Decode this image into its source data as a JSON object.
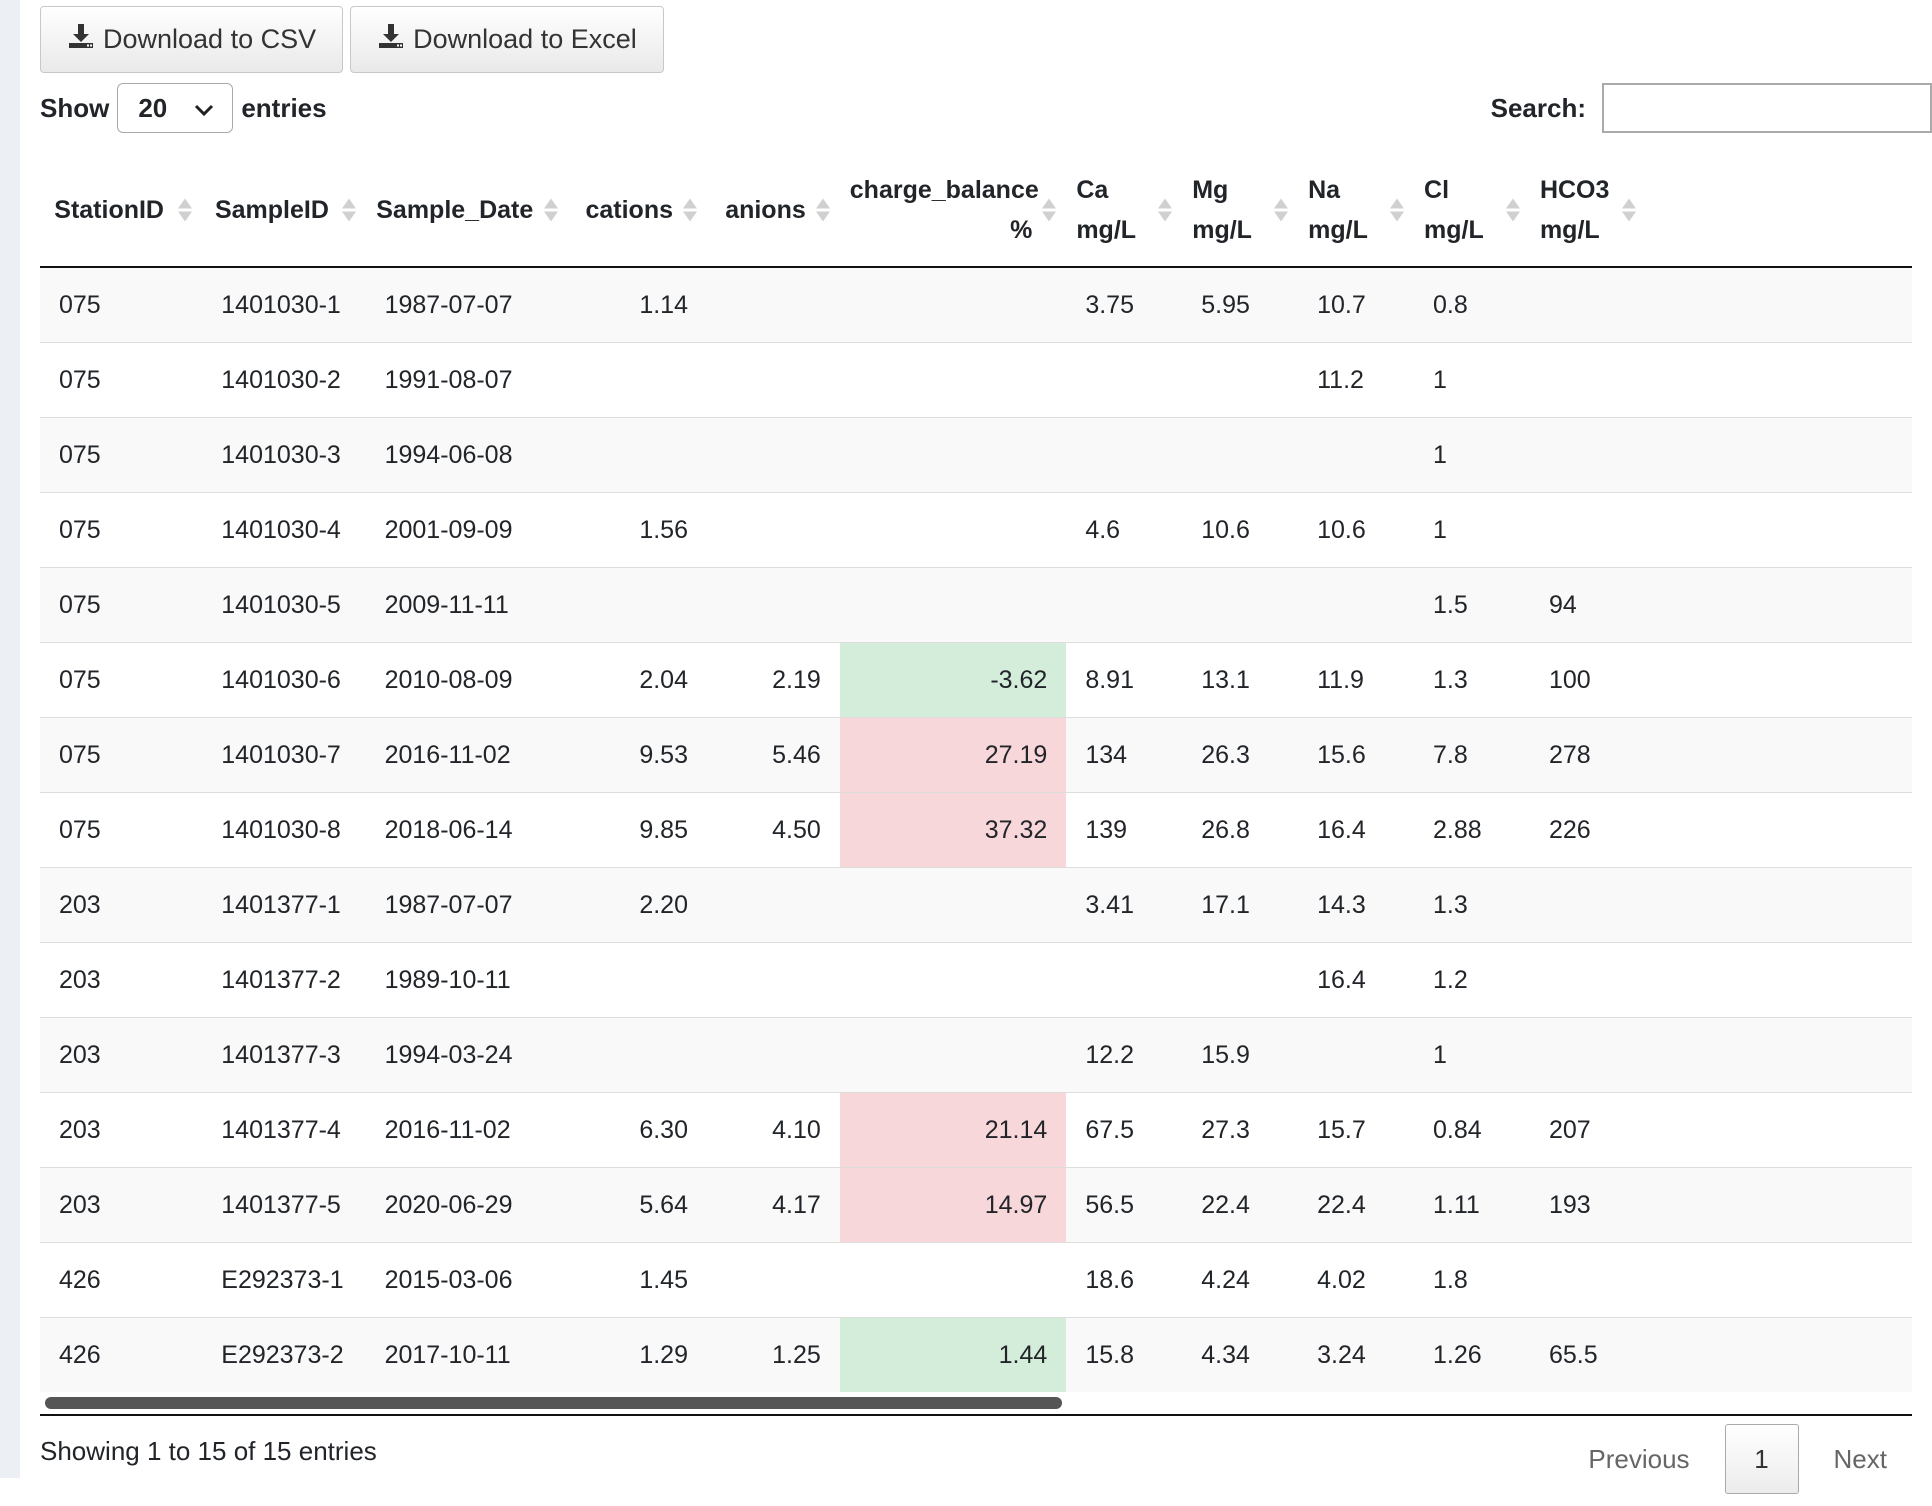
{
  "toolbar": {
    "csv_label": "Download to CSV",
    "excel_label": "Download to Excel"
  },
  "length": {
    "show_label": "Show",
    "selected": "20",
    "entries_label": "entries"
  },
  "search": {
    "label": "Search:",
    "value": ""
  },
  "table": {
    "headers": [
      {
        "l1": "StationID",
        "l2": ""
      },
      {
        "l1": "SampleID",
        "l2": ""
      },
      {
        "l1": "Sample_Date",
        "l2": ""
      },
      {
        "l1": "cations",
        "l2": ""
      },
      {
        "l1": "anions",
        "l2": ""
      },
      {
        "l1": "charge_balance",
        "l2": "%"
      },
      {
        "l1": "Ca",
        "l2": "mg/L"
      },
      {
        "l1": "Mg",
        "l2": "mg/L"
      },
      {
        "l1": "Na",
        "l2": "mg/L"
      },
      {
        "l1": "Cl",
        "l2": "mg/L"
      },
      {
        "l1": "HCO3",
        "l2": "mg/L"
      }
    ],
    "rows": [
      {
        "station": "075",
        "sample": "1401030-1",
        "date": "1987-07-07",
        "cations": "1.14",
        "anions": "",
        "cb": "",
        "ca": "3.75",
        "mg": "5.95",
        "na": "10.7",
        "cl": "0.8",
        "hco3": ""
      },
      {
        "station": "075",
        "sample": "1401030-2",
        "date": "1991-08-07",
        "cations": "",
        "anions": "",
        "cb": "",
        "ca": "",
        "mg": "",
        "na": "11.2",
        "cl": "1",
        "hco3": ""
      },
      {
        "station": "075",
        "sample": "1401030-3",
        "date": "1994-06-08",
        "cations": "",
        "anions": "",
        "cb": "",
        "ca": "",
        "mg": "",
        "na": "",
        "cl": "1",
        "hco3": ""
      },
      {
        "station": "075",
        "sample": "1401030-4",
        "date": "2001-09-09",
        "cations": "1.56",
        "anions": "",
        "cb": "",
        "ca": "4.6",
        "mg": "10.6",
        "na": "10.6",
        "cl": "1",
        "hco3": ""
      },
      {
        "station": "075",
        "sample": "1401030-5",
        "date": "2009-11-11",
        "cations": "",
        "anions": "",
        "cb": "",
        "ca": "",
        "mg": "",
        "na": "",
        "cl": "1.5",
        "hco3": "94"
      },
      {
        "station": "075",
        "sample": "1401030-6",
        "date": "2010-08-09",
        "cations": "2.04",
        "anions": "2.19",
        "cb": "-3.62",
        "ca": "8.91",
        "mg": "13.1",
        "na": "11.9",
        "cl": "1.3",
        "hco3": "100"
      },
      {
        "station": "075",
        "sample": "1401030-7",
        "date": "2016-11-02",
        "cations": "9.53",
        "anions": "5.46",
        "cb": "27.19",
        "ca": "134",
        "mg": "26.3",
        "na": "15.6",
        "cl": "7.8",
        "hco3": "278"
      },
      {
        "station": "075",
        "sample": "1401030-8",
        "date": "2018-06-14",
        "cations": "9.85",
        "anions": "4.50",
        "cb": "37.32",
        "ca": "139",
        "mg": "26.8",
        "na": "16.4",
        "cl": "2.88",
        "hco3": "226"
      },
      {
        "station": "203",
        "sample": "1401377-1",
        "date": "1987-07-07",
        "cations": "2.20",
        "anions": "",
        "cb": "",
        "ca": "3.41",
        "mg": "17.1",
        "na": "14.3",
        "cl": "1.3",
        "hco3": ""
      },
      {
        "station": "203",
        "sample": "1401377-2",
        "date": "1989-10-11",
        "cations": "",
        "anions": "",
        "cb": "",
        "ca": "",
        "mg": "",
        "na": "16.4",
        "cl": "1.2",
        "hco3": ""
      },
      {
        "station": "203",
        "sample": "1401377-3",
        "date": "1994-03-24",
        "cations": "",
        "anions": "",
        "cb": "",
        "ca": "12.2",
        "mg": "15.9",
        "na": "",
        "cl": "1",
        "hco3": ""
      },
      {
        "station": "203",
        "sample": "1401377-4",
        "date": "2016-11-02",
        "cations": "6.30",
        "anions": "4.10",
        "cb": "21.14",
        "ca": "67.5",
        "mg": "27.3",
        "na": "15.7",
        "cl": "0.84",
        "hco3": "207"
      },
      {
        "station": "203",
        "sample": "1401377-5",
        "date": "2020-06-29",
        "cations": "5.64",
        "anions": "4.17",
        "cb": "14.97",
        "ca": "56.5",
        "mg": "22.4",
        "na": "22.4",
        "cl": "1.11",
        "hco3": "193"
      },
      {
        "station": "426",
        "sample": "E292373-1",
        "date": "2015-03-06",
        "cations": "1.45",
        "anions": "",
        "cb": "",
        "ca": "18.6",
        "mg": "4.24",
        "na": "4.02",
        "cl": "1.8",
        "hco3": ""
      },
      {
        "station": "426",
        "sample": "E292373-2",
        "date": "2017-10-11",
        "cations": "1.29",
        "anions": "1.25",
        "cb": "1.44",
        "ca": "15.8",
        "mg": "4.34",
        "na": "3.24",
        "cl": "1.26",
        "hco3": "65.5"
      }
    ]
  },
  "colors": {
    "charge_balance_ok": "#d4edda",
    "charge_balance_bad": "#f8d7da"
  },
  "footer": {
    "info": "Showing 1 to 15 of 15 entries",
    "previous": "Previous",
    "page": "1",
    "next": "Next"
  }
}
